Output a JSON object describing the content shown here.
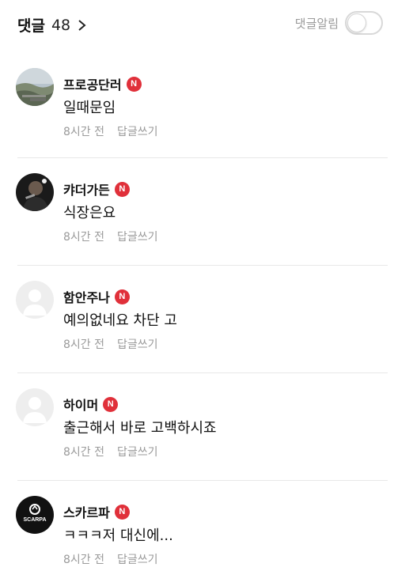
{
  "header": {
    "title": "댓글",
    "count": "48",
    "notify_label": "댓글알림",
    "notify_on": false
  },
  "comments": [
    {
      "name": "프로공단러",
      "badge": "N",
      "text": "일때문임",
      "time": "8시간 전",
      "reply": "답글쓰기"
    },
    {
      "name": "캬더가든",
      "badge": "N",
      "text": "식장은요",
      "time": "8시간 전",
      "reply": "답글쓰기"
    },
    {
      "name": "함안주나",
      "badge": "N",
      "text": "예의없네요 차단 고",
      "time": "8시간 전",
      "reply": "답글쓰기"
    },
    {
      "name": "하이머",
      "badge": "N",
      "text": "출근해서 바로 고백하시죠",
      "time": "8시간 전",
      "reply": "답글쓰기"
    },
    {
      "name": "스카르파",
      "badge": "N",
      "text": "ㅋㅋㅋ저 대신에...",
      "time": "8시간 전",
      "reply": "답글쓰기"
    }
  ],
  "avatar_logo_text": "SCARPA",
  "colors": {
    "badge": "#e0303a",
    "meta": "#9a9a9a",
    "divider": "#e8e8e8"
  }
}
